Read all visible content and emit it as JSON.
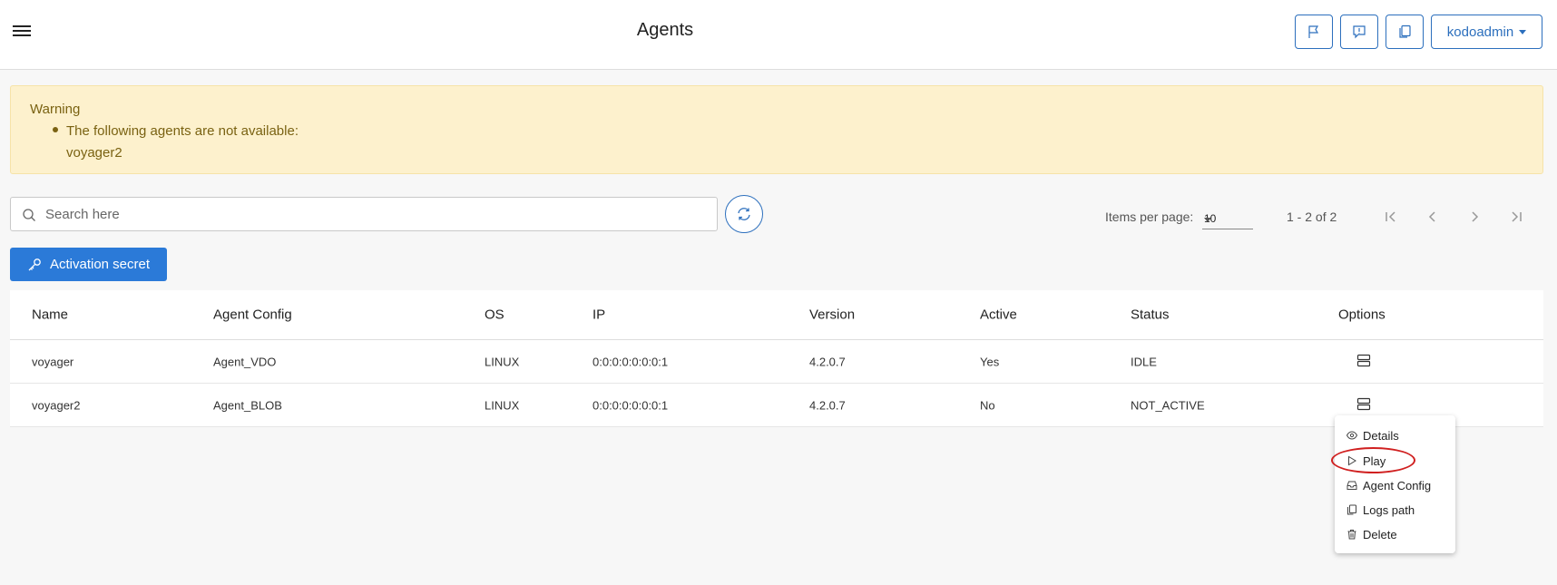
{
  "header": {
    "title": "Agents",
    "user": "kodoadmin",
    "icons": [
      "flag-icon",
      "feedback-icon",
      "copy-icon"
    ]
  },
  "warning": {
    "title": "Warning",
    "message": "The following agents are not available:",
    "agents": "voyager2"
  },
  "search": {
    "placeholder": "Search here",
    "value": ""
  },
  "pagination": {
    "items_per_page_label": "Items per page:",
    "items_per_page": "10",
    "range": "1 - 2 of 2"
  },
  "activation_button": "Activation secret",
  "table": {
    "columns": [
      "Name",
      "Agent Config",
      "OS",
      "IP",
      "Version",
      "Active",
      "Status",
      "Options"
    ],
    "rows": [
      {
        "name": "voyager",
        "config": "Agent_VDO",
        "os": "LINUX",
        "ip": "0:0:0:0:0:0:0:1",
        "version": "4.2.0.7",
        "active": "Yes",
        "status": "IDLE"
      },
      {
        "name": "voyager2",
        "config": "Agent_BLOB",
        "os": "LINUX",
        "ip": "0:0:0:0:0:0:0:1",
        "version": "4.2.0.7",
        "active": "No",
        "status": "NOT_ACTIVE"
      }
    ]
  },
  "context_menu": {
    "items": [
      "Details",
      "Play",
      "Agent Config",
      "Logs path",
      "Delete"
    ]
  },
  "colors": {
    "primary": "#2b7ad8",
    "outline": "#2c6fbd",
    "warning_bg": "#fdf1cd",
    "warning_text": "#7a6212",
    "status_green": "#3a9a3a",
    "highlight": "#d02020"
  }
}
